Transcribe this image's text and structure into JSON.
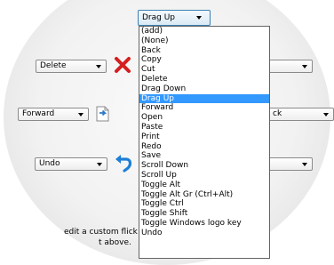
{
  "top_select": {
    "value": "Drag Up"
  },
  "rows": [
    {
      "value": "Delete",
      "icon": "red-x-delete-icon"
    },
    {
      "value": "Forward",
      "icon": "document-forward-icon"
    },
    {
      "value": "Undo",
      "icon": "blue-undo-arrow-icon"
    }
  ],
  "right_selects": {
    "middle_partial": "ck"
  },
  "hint": {
    "line1": "edit a custom flick",
    "line2": "t above."
  },
  "dropdown": {
    "selected": "Drag Up",
    "items": [
      "(add)",
      "(None)",
      "Back",
      "Copy",
      "Cut",
      "Delete",
      "Drag Down",
      "Drag Up",
      "Forward",
      "Open",
      "Paste",
      "Print",
      "Redo",
      "Save",
      "Scroll Down",
      "Scroll Up",
      "Toggle Alt",
      "Toggle Alt Gr (Ctrl+Alt)",
      "Toggle Ctrl",
      "Toggle Shift",
      "Toggle Windows logo key",
      "Undo"
    ]
  },
  "colors": {
    "highlight": "#3399ff",
    "delete_icon": "#d42020",
    "undo_icon": "#1e7fd6"
  }
}
